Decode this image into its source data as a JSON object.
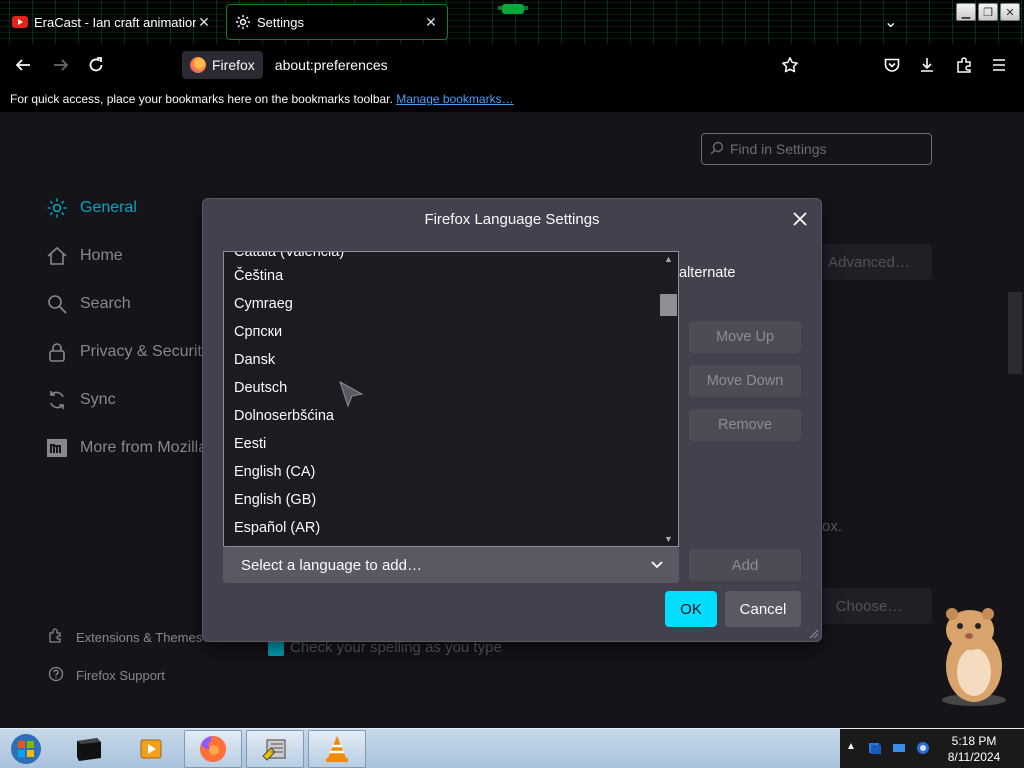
{
  "tabs": [
    {
      "title": "EraCast - Ian craft animation",
      "icon": "youtube-icon",
      "active": false
    },
    {
      "title": "Settings",
      "icon": "gear-icon",
      "active": true
    }
  ],
  "nav": {
    "identity_label": "Firefox",
    "url": "about:preferences"
  },
  "bookmarks_bar": {
    "message": "For quick access, place your bookmarks here on the bookmarks toolbar.",
    "link": "Manage bookmarks…"
  },
  "settings": {
    "find_placeholder": "Find in Settings",
    "categories": [
      {
        "label": "General",
        "icon": "gear-icon",
        "selected": true
      },
      {
        "label": "Home",
        "icon": "home-icon",
        "selected": false
      },
      {
        "label": "Search",
        "icon": "search-icon",
        "selected": false
      },
      {
        "label": "Privacy & Security",
        "icon": "lock-icon",
        "selected": false
      },
      {
        "label": "Sync",
        "icon": "sync-icon",
        "selected": false
      },
      {
        "label": "More from Mozilla",
        "icon": "mozilla-icon",
        "selected": false
      }
    ],
    "footer_links": [
      {
        "label": "Extensions & Themes",
        "icon": "puzzle-icon"
      },
      {
        "label": "Firefox Support",
        "icon": "help-icon"
      }
    ],
    "bg_advanced_button": "Advanced…",
    "bg_choose_button": "Choose…",
    "bg_text_ox": "ox.",
    "bg_spell_check": "Check your spelling as you type"
  },
  "dialog": {
    "title": "Firefox Language Settings",
    "list_cut_item": "Català (Valencià)",
    "languages": [
      "Čeština",
      "Cymraeg",
      "Српски",
      "Dansk",
      "Deutsch",
      "Dolnoserbšćina",
      "Eesti",
      "English (CA)",
      "English (GB)",
      "Español (AR)"
    ],
    "alternate_text": "alternate",
    "move_up": "Move Up",
    "move_down": "Move Down",
    "remove": "Remove",
    "select_placeholder": "Select a language to add…",
    "add": "Add",
    "ok": "OK",
    "cancel": "Cancel"
  },
  "taskbar": {
    "time": "5:18 PM",
    "date": "8/11/2024"
  },
  "colors": {
    "accent": "#00ddff",
    "page_bg": "#1c1b22",
    "dialog_bg": "#42414d"
  }
}
